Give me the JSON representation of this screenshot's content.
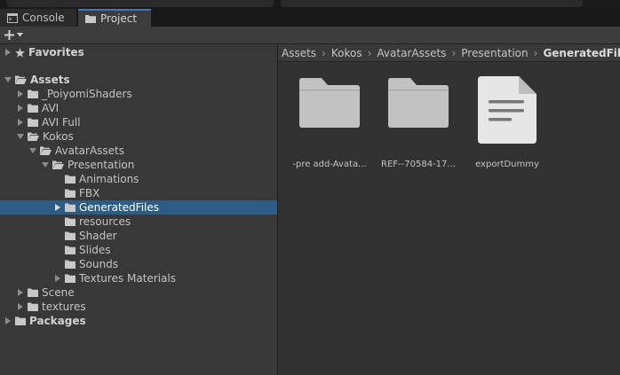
{
  "tabs": [
    {
      "label": "Console",
      "icon": "console-icon"
    },
    {
      "label": "Project",
      "icon": "folder-icon"
    }
  ],
  "toolbar": {
    "add_label": "+"
  },
  "tree": [
    {
      "label": "Favorites",
      "icon": "star-icon",
      "depth": 0,
      "arrow": "right",
      "header": true
    },
    {
      "label": "Assets",
      "icon": "folder-open-icon",
      "depth": 0,
      "arrow": "down",
      "header": true
    },
    {
      "label": "_PoiyomiShaders",
      "icon": "folder-icon",
      "depth": 1,
      "arrow": "right"
    },
    {
      "label": "AVI",
      "icon": "folder-icon",
      "depth": 1,
      "arrow": "right"
    },
    {
      "label": "AVI Full",
      "icon": "folder-icon",
      "depth": 1,
      "arrow": "right"
    },
    {
      "label": "Kokos",
      "icon": "folder-open-icon",
      "depth": 1,
      "arrow": "down"
    },
    {
      "label": "AvatarAssets",
      "icon": "folder-open-icon",
      "depth": 2,
      "arrow": "down"
    },
    {
      "label": "Presentation",
      "icon": "folder-open-icon",
      "depth": 3,
      "arrow": "down"
    },
    {
      "label": "Animations",
      "icon": "folder-icon",
      "depth": 4,
      "arrow": ""
    },
    {
      "label": "FBX",
      "icon": "folder-icon",
      "depth": 4,
      "arrow": ""
    },
    {
      "label": "GeneratedFiles",
      "icon": "folder-icon",
      "depth": 4,
      "arrow": "right",
      "selected": true
    },
    {
      "label": "resources",
      "icon": "folder-icon",
      "depth": 4,
      "arrow": ""
    },
    {
      "label": "Shader",
      "icon": "folder-icon",
      "depth": 4,
      "arrow": ""
    },
    {
      "label": "Slides",
      "icon": "folder-icon",
      "depth": 4,
      "arrow": ""
    },
    {
      "label": "Sounds",
      "icon": "folder-icon",
      "depth": 4,
      "arrow": ""
    },
    {
      "label": "Textures Materials",
      "icon": "folder-icon",
      "depth": 4,
      "arrow": "right"
    },
    {
      "label": "Scene",
      "icon": "folder-icon",
      "depth": 1,
      "arrow": "right"
    },
    {
      "label": "textures",
      "icon": "folder-icon",
      "depth": 1,
      "arrow": "right"
    },
    {
      "label": "Packages",
      "icon": "folder-icon",
      "depth": 0,
      "arrow": "right",
      "header": true
    }
  ],
  "breadcrumb": [
    "Assets",
    "Kokos",
    "AvatarAssets",
    "Presentation",
    "GeneratedFiles"
  ],
  "files": [
    {
      "label": "-pre add-Avata...",
      "icon": "folder-large-icon"
    },
    {
      "label": "REF--70584-17...",
      "icon": "folder-large-icon"
    },
    {
      "label": "exportDummy",
      "icon": "document-icon"
    }
  ]
}
